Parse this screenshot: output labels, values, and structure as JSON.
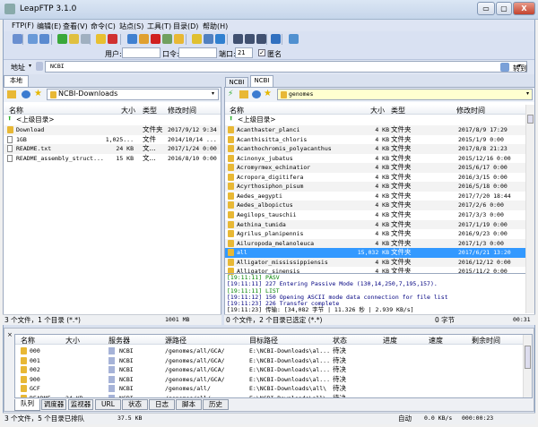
{
  "app": {
    "title": "LeapFTP 3.1.0",
    "minimize": "▭",
    "maximize": "▢",
    "close": "X"
  },
  "menu": [
    "FTP(F)",
    "编辑(E)",
    "查看(V)",
    "命令(C)",
    "站点(S)",
    "工具(T)",
    "目录(D)",
    "帮助(H)"
  ],
  "login": {
    "user_label": "用户:",
    "user_value": "",
    "pass_label": "口令:",
    "pass_value": "",
    "port_label": "端口:",
    "port_value": "21",
    "anon_label": "匿名",
    "anon_checked": true
  },
  "address": {
    "label": "地址",
    "value": "NCBI",
    "go": "转到"
  },
  "local": {
    "tab": "本地",
    "path": "NCBI-Downloads",
    "columns": [
      "名称",
      "大小",
      "类型",
      "修改时间"
    ],
    "parent": "<上级目录>",
    "files": [
      {
        "name": "Download",
        "size": "",
        "type": "文件夹",
        "date": "2017/9/12 9:34",
        "folder": true
      },
      {
        "name": "1GB",
        "size": "1,025...",
        "type": "文件",
        "date": "2014/10/14 ...",
        "folder": false
      },
      {
        "name": "README.txt",
        "size": "24 KB",
        "type": "文...",
        "date": "2017/1/24 0:00",
        "folder": false
      },
      {
        "name": "README_assembly_struct...",
        "size": "15 KB",
        "type": "文...",
        "date": "2016/8/10 0:00",
        "folder": false
      }
    ],
    "status": "3 个文件，1 个目录 (*.*)",
    "status_size": "1001 MB"
  },
  "remote": {
    "tabs": [
      "NCBI",
      "NCBI"
    ],
    "path": "genomes",
    "columns": [
      "名称",
      "大小",
      "类型",
      "修改时间"
    ],
    "parent": "<上级目录>",
    "files": [
      {
        "name": "Acanthaster_planci",
        "size": "4 KB",
        "type": "文件夹",
        "date": "2017/8/9 17:29"
      },
      {
        "name": "Acanthisitta_chloris",
        "size": "4 KB",
        "type": "文件夹",
        "date": "2015/1/9 0:00"
      },
      {
        "name": "Acanthochromis_polyacanthus",
        "size": "4 KB",
        "type": "文件夹",
        "date": "2017/8/8 21:23"
      },
      {
        "name": "Acinonyx_jubatus",
        "size": "4 KB",
        "type": "文件夹",
        "date": "2015/12/16 0:00"
      },
      {
        "name": "Acromyrmex_echinatior",
        "size": "4 KB",
        "type": "文件夹",
        "date": "2015/6/17 0:00"
      },
      {
        "name": "Acropora_digitifera",
        "size": "4 KB",
        "type": "文件夹",
        "date": "2016/3/15 0:00"
      },
      {
        "name": "Acyrthosiphon_pisum",
        "size": "4 KB",
        "type": "文件夹",
        "date": "2016/5/18 0:00"
      },
      {
        "name": "Aedes_aegypti",
        "size": "4 KB",
        "type": "文件夹",
        "date": "2017/7/20 18:44"
      },
      {
        "name": "Aedes_albopictus",
        "size": "4 KB",
        "type": "文件夹",
        "date": "2017/2/6 0:00"
      },
      {
        "name": "Aegilops_tauschii",
        "size": "4 KB",
        "type": "文件夹",
        "date": "2017/3/3 0:00"
      },
      {
        "name": "Aethina_tumida",
        "size": "4 KB",
        "type": "文件夹",
        "date": "2017/1/19 0:00"
      },
      {
        "name": "Agrilus_planipennis",
        "size": "4 KB",
        "type": "文件夹",
        "date": "2016/9/23 0:00"
      },
      {
        "name": "Ailuropoda_melanoleuca",
        "size": "4 KB",
        "type": "文件夹",
        "date": "2017/1/3 0:00"
      },
      {
        "name": "all",
        "size": "15,032 KB",
        "type": "文件夹",
        "date": "2017/6/21 13:20",
        "selected": true
      },
      {
        "name": "Alligator_mississippiensis",
        "size": "4 KB",
        "type": "文件夹",
        "date": "2016/12/12 0:00"
      },
      {
        "name": "Alligator_sinensis",
        "size": "4 KB",
        "type": "文件夹",
        "date": "2015/11/2 0:00"
      }
    ],
    "log": [
      {
        "text": "[19:11:11] PASV",
        "color": "#008000"
      },
      {
        "text": "[19:11:11] 227 Entering Passive Mode (130,14,250,7,195,157).",
        "color": "#000080"
      },
      {
        "text": "[19:11:11] LIST",
        "color": "#008000"
      },
      {
        "text": "[19:11:12] 150 Opening ASCII mode data connection for file list",
        "color": "#000080"
      },
      {
        "text": "[19:11:23] 226 Transfer complete",
        "color": "#000080"
      },
      {
        "text": "[19:11:23] 传输: [34,082 字节 | 11.326 秒 | 2.939 KB/s]",
        "color": "#000000"
      }
    ],
    "status": "0 个文件，2 个目录已选定 (*.*)",
    "status_size": "0 字节",
    "status_time": "00:31"
  },
  "queue": {
    "columns": [
      "名称",
      "大小",
      "服务器",
      "源路径",
      "目标路径",
      "状态",
      "进度",
      "速度",
      "剩余时间"
    ],
    "rows": [
      {
        "name": "000",
        "size": "",
        "server": "NCBI",
        "src": "/genomes/all/GCA/",
        "dst": "E:\\NCBI-Downloads\\al...",
        "state": "待决"
      },
      {
        "name": "001",
        "size": "",
        "server": "NCBI",
        "src": "/genomes/all/GCA/",
        "dst": "E:\\NCBI-Downloads\\al...",
        "state": "待决"
      },
      {
        "name": "002",
        "size": "",
        "server": "NCBI",
        "src": "/genomes/all/GCA/",
        "dst": "E:\\NCBI-Downloads\\al...",
        "state": "待决"
      },
      {
        "name": "900",
        "size": "",
        "server": "NCBI",
        "src": "/genomes/all/GCA/",
        "dst": "E:\\NCBI-Downloads\\al...",
        "state": "待决"
      },
      {
        "name": "GCF",
        "size": "",
        "server": "NCBI",
        "src": "/genomes/all/",
        "dst": "E:\\NCBI-Downloads\\all\\",
        "state": "待决"
      },
      {
        "name": "README",
        "size": "24 KB",
        "server": "NCBI",
        "src": "/genomes/all/",
        "dst": "E:\\NCBI-Downloads\\all\\",
        "state": "待决"
      }
    ],
    "tabs": [
      "队列",
      "调度器",
      "监视器",
      "URL",
      "状态",
      "日志",
      "脚本",
      "历史"
    ]
  },
  "statusbar": {
    "text": "3 个文件，5 个目录已排队",
    "size": "37.5 KB",
    "mode": "自动",
    "speed": "0.0 KB/s",
    "time": "000:00:23"
  }
}
